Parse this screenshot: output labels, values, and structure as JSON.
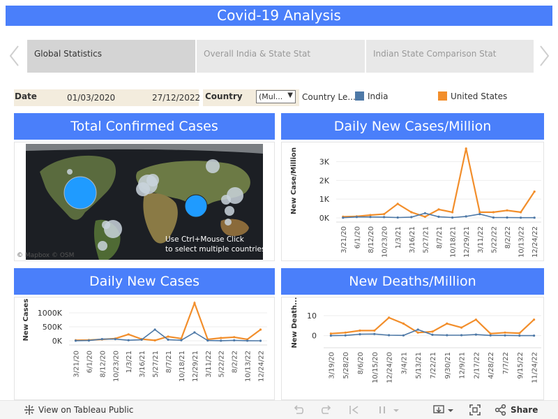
{
  "header": {
    "title": "Covid-19 Analysis"
  },
  "tabs": [
    {
      "label": "Global Statistics",
      "active": true
    },
    {
      "label": "Overall India & State Stat",
      "active": false
    },
    {
      "label": "Indian State Comparison Stat",
      "active": false
    }
  ],
  "filters": {
    "date_label": "Date",
    "date_start": "01/03/2020",
    "date_end": "27/12/2022",
    "country_label": "Country",
    "country_value": "(Mul...",
    "legend_title": "Country Le...",
    "legend": [
      {
        "label": "India",
        "color": "#4e79a7"
      },
      {
        "label": "United States",
        "color": "#f28e2b"
      }
    ]
  },
  "colors": {
    "accent": "#4a7ffa",
    "india": "#4e79a7",
    "us": "#f28e2b"
  },
  "panels": {
    "confirmed": {
      "title": "Total Confirmed Cases",
      "attribution": "© Mapbox  © OSM",
      "hint_line1": "Use Ctrl+Mouse Click",
      "hint_line2": "to select multiple countries"
    },
    "cases_per_million": {
      "title": "Daily New Cases/Million",
      "ylabel": "New Case/Million",
      "yticks": [
        "3K",
        "2K",
        "1K",
        "0K"
      ],
      "xticks": [
        "3/21/20",
        "6/1/20",
        "8/12/20",
        "10/23/20",
        "1/3/21",
        "3/16/21",
        "5/27/21",
        "8/7/21",
        "10/18/21",
        "12/29/21",
        "3/11/22",
        "5/22/22",
        "8/2/22",
        "10/13/22",
        "12/24/22"
      ]
    },
    "daily_cases": {
      "title": "Daily New Cases",
      "ylabel": "New Cases",
      "yticks": [
        "1000K",
        "500K",
        "0K"
      ],
      "xticks": [
        "3/21/20",
        "6/1/20",
        "8/12/20",
        "10/23/20",
        "1/3/21",
        "3/16/21",
        "5/27/21",
        "8/7/21",
        "10/18/21",
        "12/29/21",
        "3/11/22",
        "5/22/22",
        "8/2/22",
        "10/13/22",
        "12/24/22"
      ]
    },
    "deaths_per_million": {
      "title": "New Deaths/Million",
      "ylabel": "New Death...",
      "yticks": [
        "10",
        "0"
      ],
      "xticks": [
        "3/19/20",
        "5/28/20",
        "8/6/20",
        "10/15/20",
        "12/24/20",
        "3/4/21",
        "5/13/21",
        "7/22/21",
        "9/30/21",
        "12/9/21",
        "2/17/22",
        "4/28/22",
        "7/7/22",
        "9/15/22",
        "11/24/22"
      ]
    }
  },
  "chart_data": [
    {
      "type": "line",
      "title": "Daily New Cases/Million",
      "ylabel": "New Case/Million",
      "ylim": [
        0,
        3800
      ],
      "x": [
        "3/21/20",
        "6/1/20",
        "8/12/20",
        "10/23/20",
        "1/3/21",
        "3/16/21",
        "5/27/21",
        "8/7/21",
        "10/18/21",
        "12/29/21",
        "3/11/22",
        "5/22/22",
        "8/2/22",
        "10/13/22",
        "12/24/22"
      ],
      "series": [
        {
          "name": "India",
          "values": [
            10,
            50,
            50,
            40,
            20,
            40,
            250,
            60,
            20,
            80,
            200,
            20,
            20,
            10,
            10
          ]
        },
        {
          "name": "United States",
          "values": [
            60,
            80,
            150,
            200,
            750,
            300,
            60,
            450,
            300,
            3700,
            300,
            300,
            400,
            300,
            1400
          ]
        }
      ]
    },
    {
      "type": "line",
      "title": "Daily New Cases",
      "ylabel": "New Cases",
      "ylim": [
        0,
        1400000
      ],
      "x": [
        "3/21/20",
        "6/1/20",
        "8/12/20",
        "10/23/20",
        "1/3/21",
        "3/16/21",
        "5/27/21",
        "8/7/21",
        "10/18/21",
        "12/29/21",
        "3/11/22",
        "5/22/22",
        "8/2/22",
        "10/13/22",
        "12/24/22"
      ],
      "series": [
        {
          "name": "India",
          "values": [
            2000,
            10000,
            60000,
            60000,
            20000,
            40000,
            400000,
            40000,
            20000,
            300000,
            10000,
            3000,
            15000,
            3000,
            1000
          ]
        },
        {
          "name": "United States",
          "values": [
            20000,
            25000,
            50000,
            80000,
            230000,
            60000,
            15000,
            150000,
            80000,
            1350000,
            50000,
            100000,
            130000,
            50000,
            400000
          ]
        }
      ]
    },
    {
      "type": "line",
      "title": "New Deaths/Million",
      "ylabel": "New Death...",
      "ylim": [
        -4,
        17
      ],
      "x": [
        "3/19/20",
        "5/28/20",
        "8/6/20",
        "10/15/20",
        "12/24/20",
        "3/4/21",
        "5/13/21",
        "7/22/21",
        "9/30/21",
        "12/9/21",
        "2/17/22",
        "4/28/22",
        "7/7/22",
        "9/15/22",
        "11/24/22"
      ],
      "series": [
        {
          "name": "India",
          "values": [
            0,
            0.1,
            0.7,
            0.8,
            0.2,
            0.1,
            3,
            0.4,
            0.2,
            0.2,
            0.5,
            0.1,
            0.1,
            0,
            0
          ]
        },
        {
          "name": "United States",
          "values": [
            1,
            1.5,
            2.5,
            2.5,
            9,
            6,
            1.5,
            2,
            6,
            4,
            8,
            1,
            1.5,
            1.2,
            8
          ]
        }
      ]
    }
  ],
  "footer": {
    "view_label": "View on Tableau Public",
    "share_label": "Share"
  }
}
